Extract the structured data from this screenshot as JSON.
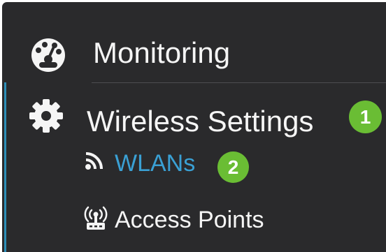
{
  "nav": {
    "monitoring": {
      "label": "Monitoring",
      "icon": "dashboard-gauge-icon"
    },
    "wireless_settings": {
      "label": "Wireless Settings",
      "icon": "gear-icon",
      "badge": "1"
    },
    "wlans": {
      "label": "WLANs",
      "icon": "wifi-feed-icon",
      "badge": "2"
    },
    "access_points": {
      "label": "Access Points",
      "icon": "access-point-icon"
    }
  },
  "colors": {
    "panel_background": "#2a2a2c",
    "text": "#f5f5f5",
    "active_link": "#3aa0d4",
    "active_indicator": "#2d8eb8",
    "badge": "#6abd34",
    "divider": "#4d4d50"
  }
}
